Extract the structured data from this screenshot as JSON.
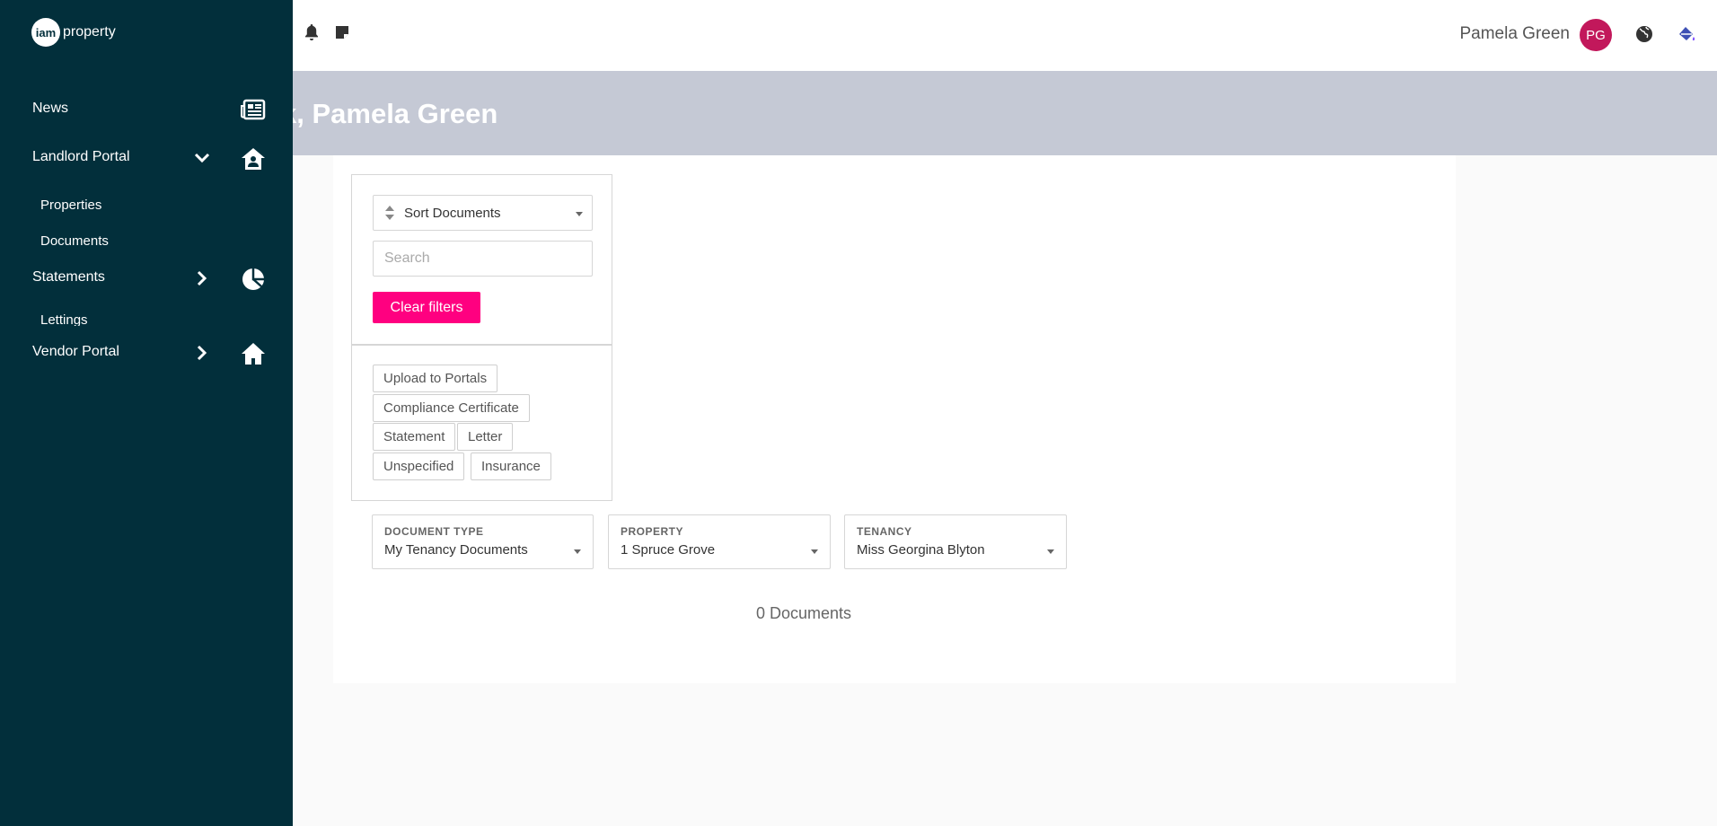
{
  "header": {
    "user_name": "Pamela Green",
    "avatar_initials": "PG",
    "icons": [
      "bell-icon",
      "sticky-note-icon",
      "globe-icon",
      "paint-bucket-icon"
    ]
  },
  "banner": {
    "title": "k, Pamela Green"
  },
  "sidebar": {
    "logo": {
      "badge": "iam",
      "text": "property"
    },
    "items": [
      {
        "label": "News",
        "icon": "newspaper-icon"
      },
      {
        "label": "Landlord Portal",
        "icon": "house-user-icon",
        "chevron": "chevron-down-icon"
      },
      {
        "label": "Properties"
      },
      {
        "label": "Documents"
      },
      {
        "label": "Statements",
        "icon": "pie-chart-icon",
        "chevron": "chevron-right-icon"
      },
      {
        "label": "Lettings"
      },
      {
        "label": "Vendor Portal",
        "icon": "home-icon",
        "chevron": "chevron-right-icon"
      }
    ]
  },
  "filters": {
    "sort_label": "Sort Documents",
    "search_placeholder": "Search",
    "clear_label": "Clear filters",
    "tags": [
      "Upload to Portals",
      "Compliance Certificate",
      "Statement",
      "Letter",
      "Unspecified",
      "Insurance"
    ]
  },
  "dropdowns": [
    {
      "label": "DOCUMENT TYPE",
      "value": "My Tenancy Documents"
    },
    {
      "label": "PROPERTY",
      "value": "1 Spruce Grove"
    },
    {
      "label": "TENANCY",
      "value": "Miss Georgina Blyton"
    }
  ],
  "result": {
    "count_text": "0 Documents"
  },
  "colors": {
    "sidebar_bg": "#022f3b",
    "banner_bg": "#c5c9d5",
    "accent": "#ff0080",
    "avatar_bg": "#c2185b"
  }
}
